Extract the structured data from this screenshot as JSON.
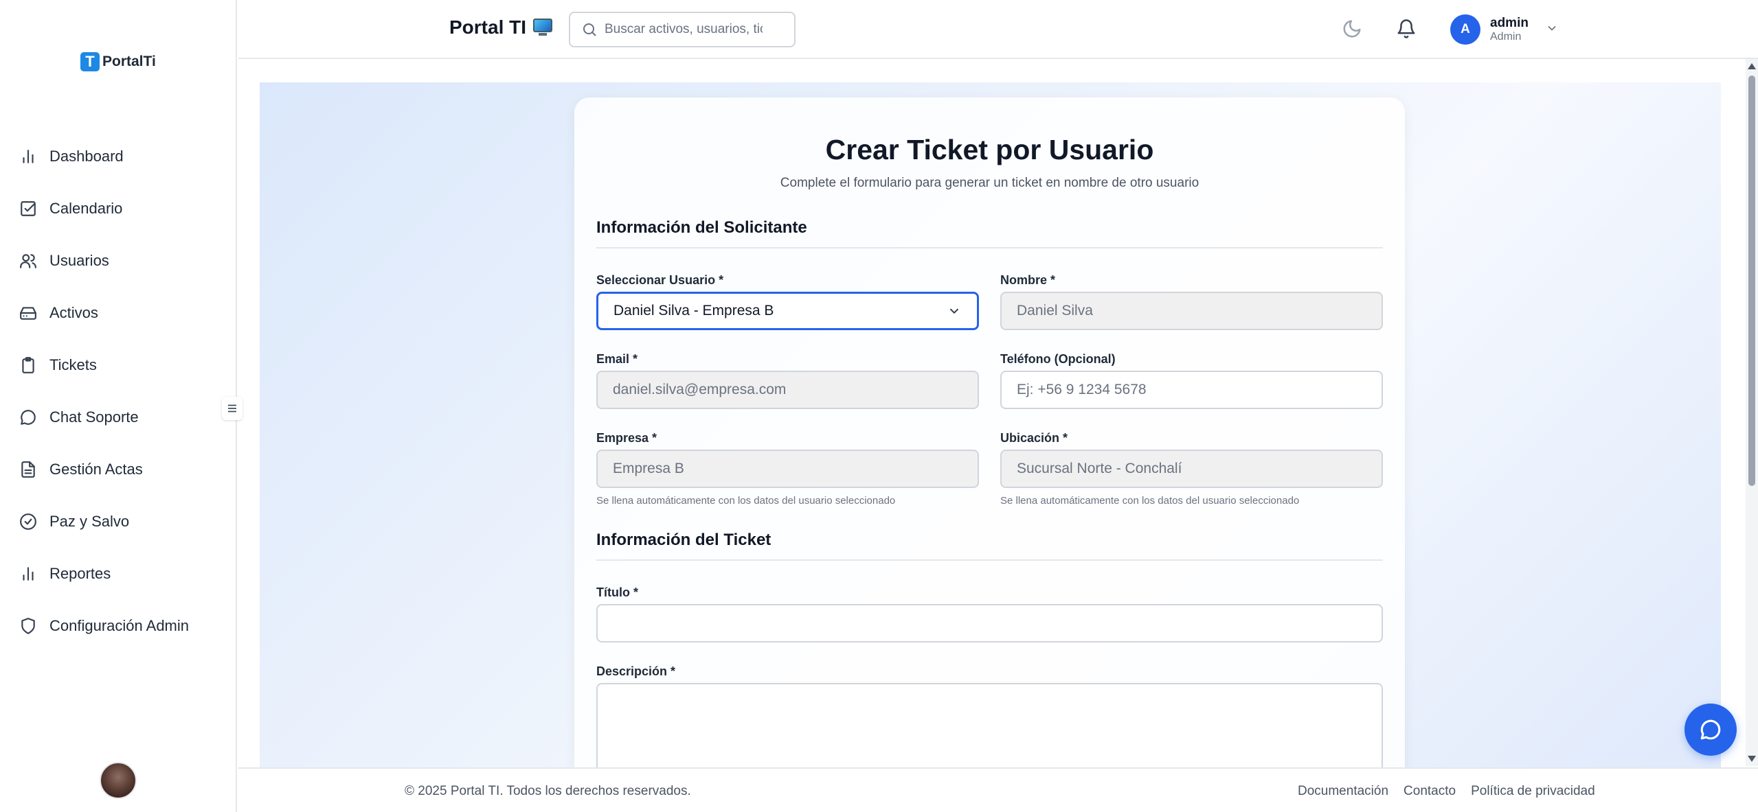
{
  "app": {
    "logo_text": "PortalTi",
    "brand": "Portal TI"
  },
  "header": {
    "search_placeholder": "Buscar activos, usuarios, tic",
    "user": {
      "initial": "A",
      "name": "admin",
      "role": "Admin"
    }
  },
  "sidebar": {
    "items": [
      {
        "label": "Dashboard",
        "icon": "bar-chart-icon"
      },
      {
        "label": "Calendario",
        "icon": "calendar-check-icon"
      },
      {
        "label": "Usuarios",
        "icon": "users-icon"
      },
      {
        "label": "Activos",
        "icon": "hard-drive-icon"
      },
      {
        "label": "Tickets",
        "icon": "clipboard-icon"
      },
      {
        "label": "Chat Soporte",
        "icon": "chat-bubble-icon"
      },
      {
        "label": "Gestión Actas",
        "icon": "document-icon"
      },
      {
        "label": "Paz y Salvo",
        "icon": "check-circle-icon"
      },
      {
        "label": "Reportes",
        "icon": "bar-chart-icon"
      },
      {
        "label": "Configuración Admin",
        "icon": "shield-icon"
      }
    ]
  },
  "form": {
    "title": "Crear Ticket por Usuario",
    "subtitle": "Complete el formulario para generar un ticket en nombre de otro usuario",
    "section_requester": "Información del Solicitante",
    "section_ticket": "Información del Ticket",
    "fields": {
      "user_select": {
        "label": "Seleccionar Usuario *",
        "value": "Daniel Silva - Empresa B"
      },
      "name": {
        "label": "Nombre *",
        "value": "Daniel Silva"
      },
      "email": {
        "label": "Email *",
        "value": "daniel.silva@empresa.com"
      },
      "phone": {
        "label": "Teléfono (Opcional)",
        "placeholder": "Ej: +56 9 1234 5678"
      },
      "company": {
        "label": "Empresa *",
        "value": "Empresa B",
        "hint": "Se llena automáticamente con los datos del usuario seleccionado"
      },
      "location": {
        "label": "Ubicación *",
        "value": "Sucursal Norte - Conchalí",
        "hint": "Se llena automáticamente con los datos del usuario seleccionado"
      },
      "title": {
        "label": "Título *",
        "value": ""
      },
      "description": {
        "label": "Descripción *",
        "value": ""
      }
    }
  },
  "footer": {
    "copyright": "© 2025 Portal TI. Todos los derechos reservados.",
    "links": [
      "Documentación",
      "Contacto",
      "Política de privacidad"
    ]
  },
  "colors": {
    "accent": "#2563eb",
    "logo": "#1e88e5"
  }
}
